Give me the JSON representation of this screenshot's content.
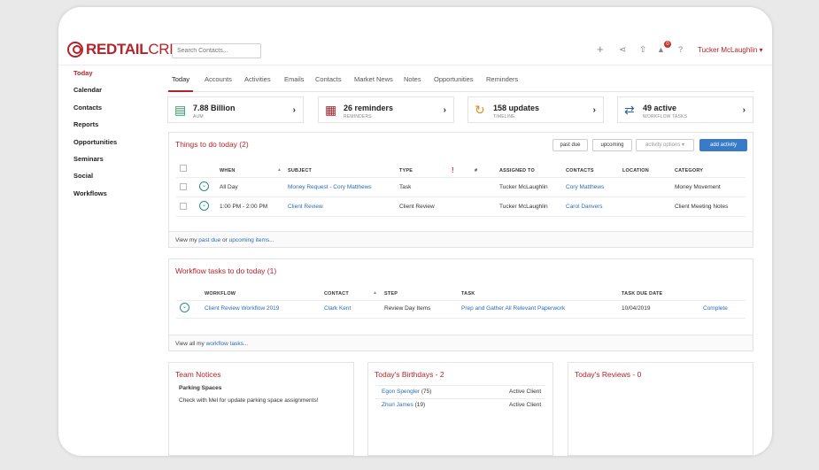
{
  "logo": {
    "bold": "REDTAIL",
    "light": "CRM"
  },
  "search": {
    "placeholder": "Search Contacts..."
  },
  "header": {
    "plus": "+",
    "share": "⋖",
    "upload": "⇧",
    "bell_count": "0",
    "help": "?",
    "user": "Tucker McLaughlin ▾"
  },
  "sidebar": {
    "items": [
      {
        "label": "Today"
      },
      {
        "label": "Calendar"
      },
      {
        "label": "Contacts"
      },
      {
        "label": "Reports"
      },
      {
        "label": "Opportunities"
      },
      {
        "label": "Seminars"
      },
      {
        "label": "Social"
      },
      {
        "label": "Workflows"
      }
    ]
  },
  "tabs": [
    {
      "label": "Today"
    },
    {
      "label": "Accounts"
    },
    {
      "label": "Activities"
    },
    {
      "label": "Emails"
    },
    {
      "label": "Contacts"
    },
    {
      "label": "Market News"
    },
    {
      "label": "Notes"
    },
    {
      "label": "Opportunities"
    },
    {
      "label": "Reminders"
    }
  ],
  "stats": [
    {
      "value": "7.88 Billion",
      "label": "AUM",
      "icon": "bar-chart-icon"
    },
    {
      "value": "26 reminders",
      "label": "REMINDERS",
      "icon": "calendar-icon"
    },
    {
      "value": "158 updates",
      "label": "TIMELINE",
      "icon": "history-icon"
    },
    {
      "value": "49 active",
      "label": "WORKFLOW TASKS",
      "icon": "shuffle-icon"
    }
  ],
  "things": {
    "title": "Things to do today (2)",
    "buttons": {
      "past_due": "past due",
      "upcoming": "upcoming",
      "activity_options": "activity options ▾",
      "add_activity": "add activity"
    },
    "headers": {
      "when": "WHEN",
      "subject": "SUBJECT",
      "type": "TYPE",
      "flag": "!",
      "num": "#",
      "assigned": "ASSIGNED TO",
      "contacts": "CONTACTS",
      "location": "LOCATION",
      "category": "CATEGORY"
    },
    "rows": [
      {
        "when": "All Day",
        "subject": "Money Request - Cory Matthews",
        "type": "Task",
        "assigned": "Tucker McLaughlin",
        "contact": "Cory Matthews",
        "category": "Money Movement"
      },
      {
        "when": "1:00 PM - 2:00 PM",
        "subject": "Client Review",
        "type": "Client Review",
        "assigned": "Tucker McLaughlin",
        "contact": "Carol Danvers",
        "category": "Client Meeting Notes"
      }
    ],
    "footer": {
      "pre": "View my ",
      "past_due": "past due",
      "mid": " or ",
      "upcoming": "upcoming items..."
    }
  },
  "workflow": {
    "title": "Workflow tasks to do today (1)",
    "headers": {
      "workflow": "WORKFLOW",
      "contact": "CONTACT",
      "step": "STEP",
      "task": "TASK",
      "due": "TASK DUE DATE"
    },
    "rows": [
      {
        "workflow": "Client Review Workflow 2019",
        "contact": "Clark Kent",
        "step": "Review Day Items",
        "task": "Prep and Gather All Relevant Paperwork",
        "due": "10/04/2019",
        "action": "Complete"
      }
    ],
    "footer": {
      "pre": "View all my ",
      "link": "workflow tasks..."
    }
  },
  "notices": {
    "title": "Team Notices",
    "heading": "Parking Spaces",
    "body": "Check with Mel for update parking space assignments!"
  },
  "birthdays": {
    "title": "Today's Birthdays - 2",
    "items": [
      {
        "name": "Egon Spengler",
        "age": "(75)",
        "status": "Active Client"
      },
      {
        "name": "Zhuri James",
        "age": "(19)",
        "status": "Active Client"
      }
    ]
  },
  "reviews": {
    "title": "Today's Reviews - 0"
  }
}
